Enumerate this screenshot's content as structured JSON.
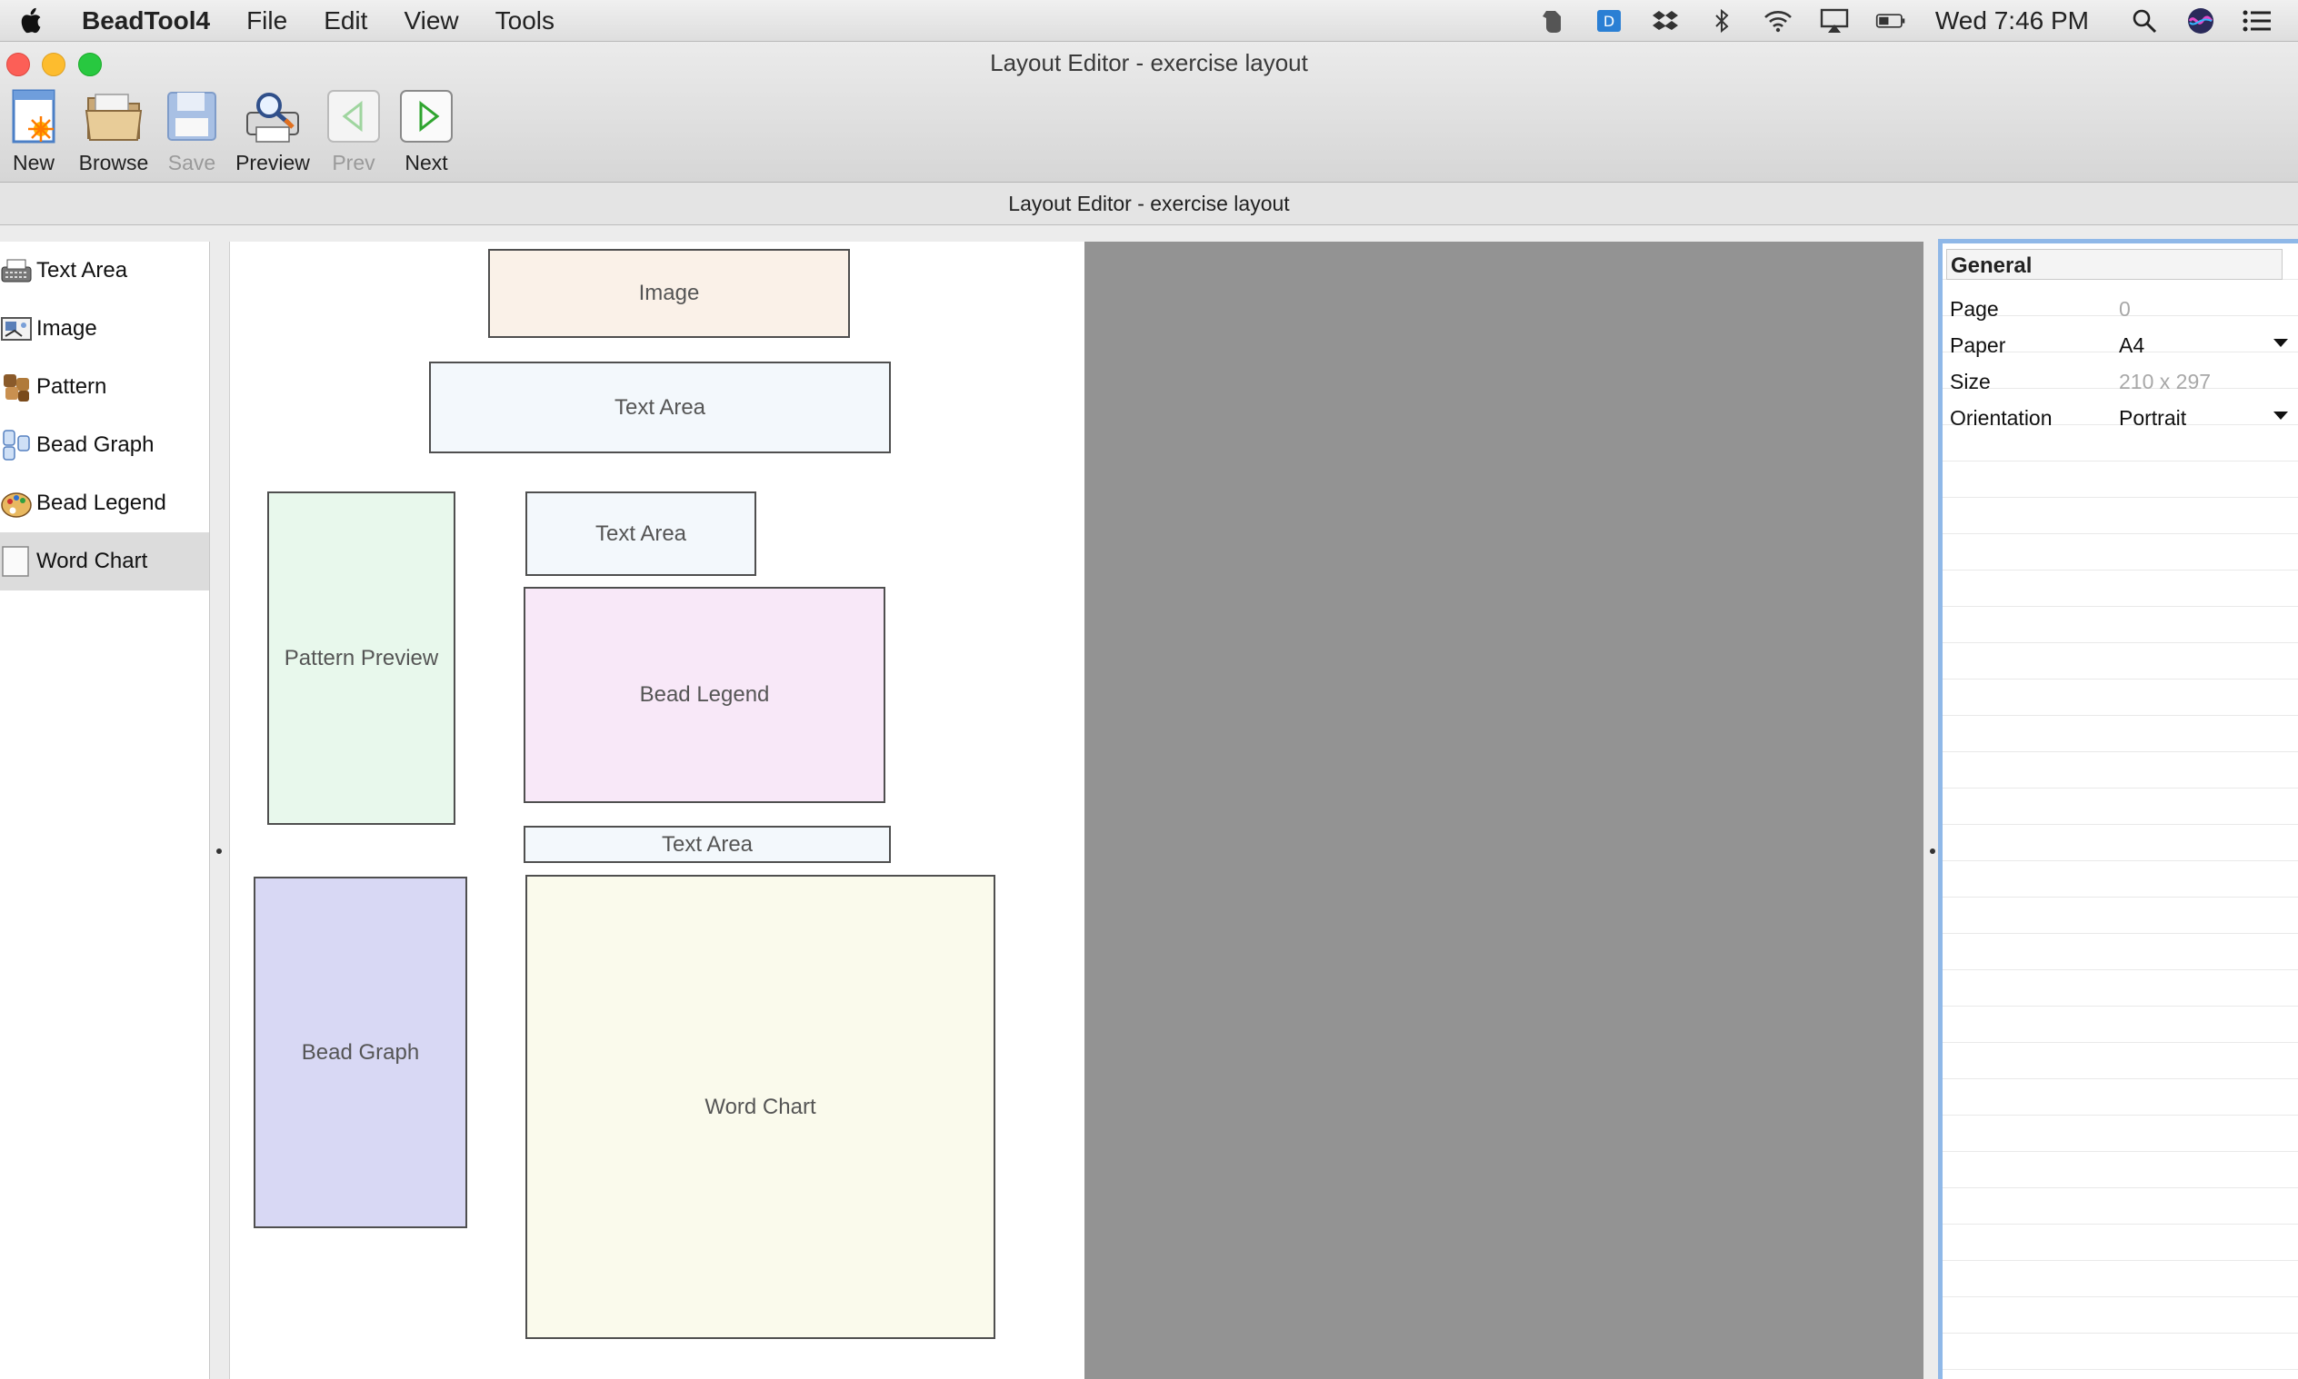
{
  "menubar": {
    "app_name": "BeadTool4",
    "menus": [
      "File",
      "Edit",
      "View",
      "Tools"
    ],
    "clock": "Wed 7:46 PM"
  },
  "window": {
    "title": "Layout Editor - exercise layout",
    "subtitle": "Layout Editor - exercise layout"
  },
  "toolbar": {
    "new_label": "New",
    "browse_label": "Browse",
    "save_label": "Save",
    "preview_label": "Preview",
    "prev_label": "Prev",
    "next_label": "Next"
  },
  "palette": {
    "items": [
      "Text Area",
      "Image",
      "Pattern",
      "Bead Graph",
      "Bead Legend",
      "Word Chart"
    ],
    "selected": "Word Chart"
  },
  "layout_blocks": {
    "image": "Image",
    "text_area_top": "Text Area",
    "pattern_preview": "Pattern Preview",
    "text_area_mid": "Text Area",
    "bead_legend": "Bead Legend",
    "text_area_small": "Text Area",
    "bead_graph": "Bead Graph",
    "word_chart": "Word Chart"
  },
  "inspector": {
    "section": "General",
    "page_label": "Page",
    "page_value": "0",
    "paper_label": "Paper",
    "paper_value": "A4",
    "size_label": "Size",
    "size_value": "210 x 297",
    "orientation_label": "Orientation",
    "orientation_value": "Portrait"
  },
  "colors": {
    "image_fill": "#faf1e8",
    "text_fill": "#f3f8fc",
    "pattern_fill": "#e8f8ec",
    "legend_fill": "#f8e8f8",
    "graph_fill": "#d8d8f4",
    "wordchart_fill": "#fafaec",
    "canvas_gray": "#939393"
  }
}
